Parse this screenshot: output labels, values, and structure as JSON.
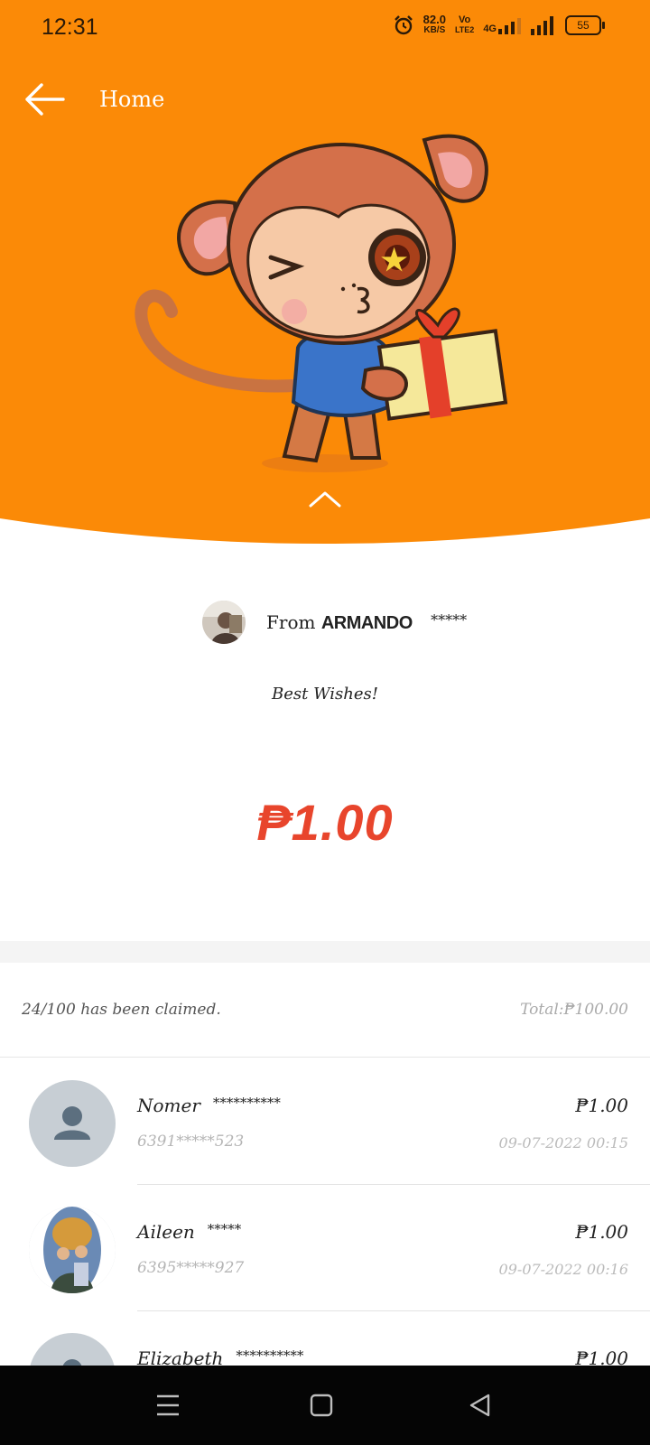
{
  "status_bar": {
    "time": "12:31",
    "speed_value": "82.0",
    "speed_unit": "KB/S",
    "volte_top": "Vo",
    "volte_bottom": "LTE2",
    "network": "4G",
    "battery": "55"
  },
  "header": {
    "back_icon": "arrow-left-icon",
    "title": "Home"
  },
  "red_packet": {
    "from_prefix": "From",
    "sender_name": "ARMANDO",
    "sender_mask": "*****",
    "message": "Best Wishes!",
    "amount": "₱1.00"
  },
  "summary": {
    "claimed_text": "24/100 has been claimed.",
    "total_text": "Total:₱100.00"
  },
  "claims": [
    {
      "name": "Nomer",
      "mask": "**********",
      "phone": "6391*****523",
      "amount": "₱1.00",
      "datetime": "09-07-2022  00:15",
      "avatar": "default-user-icon"
    },
    {
      "name": "Aileen",
      "mask": "*****",
      "phone": "6395*****927",
      "amount": "₱1.00",
      "datetime": "09-07-2022  00:16",
      "avatar": "photo"
    },
    {
      "name": "Elizabeth",
      "mask": "**********",
      "phone": "",
      "amount": "₱1.00",
      "datetime": "",
      "avatar": "default-user-icon"
    }
  ],
  "colors": {
    "brand_orange": "#fb8a07",
    "amount_red": "#e8452c",
    "nav_bg": "#050505"
  },
  "nav_icons": [
    "menu-icon",
    "home-square-icon",
    "back-triangle-icon"
  ]
}
